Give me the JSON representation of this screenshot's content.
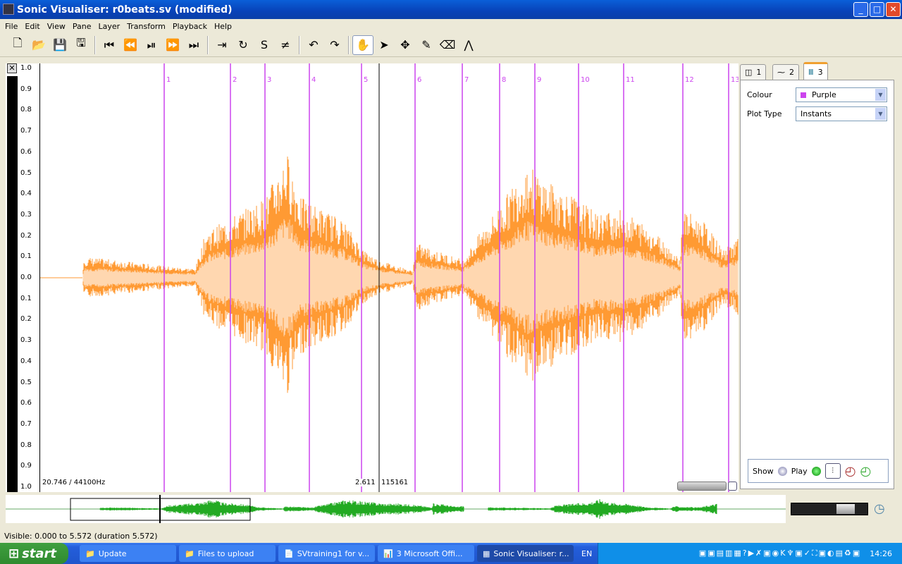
{
  "window": {
    "title": "Sonic Visualiser: r0beats.sv (modified)",
    "minimize": "_",
    "maximize": "□",
    "close": "✕"
  },
  "menu": [
    "File",
    "Edit",
    "View",
    "Pane",
    "Layer",
    "Transform",
    "Playback",
    "Help"
  ],
  "toolbar": [
    {
      "icon": "new-file-icon",
      "glyph": "🗋"
    },
    {
      "icon": "open-folder-icon",
      "glyph": "📂"
    },
    {
      "icon": "save-icon",
      "glyph": "💾"
    },
    {
      "icon": "save-as-icon",
      "glyph": "🖫"
    },
    {
      "sep": true
    },
    {
      "icon": "rewind-start-icon",
      "glyph": "⏮"
    },
    {
      "icon": "rewind-icon",
      "glyph": "⏪"
    },
    {
      "icon": "play-pause-icon",
      "glyph": "⏯"
    },
    {
      "icon": "fast-forward-icon",
      "glyph": "⏩"
    },
    {
      "icon": "fast-forward-end-icon",
      "glyph": "⏭"
    },
    {
      "sep": true
    },
    {
      "icon": "play-selection-icon",
      "glyph": "⇥"
    },
    {
      "icon": "loop-icon",
      "glyph": "↻"
    },
    {
      "icon": "solo-icon",
      "glyph": "S"
    },
    {
      "icon": "speed-icon",
      "glyph": "≠"
    },
    {
      "sep": true
    },
    {
      "icon": "undo-icon",
      "glyph": "↶"
    },
    {
      "icon": "redo-icon",
      "glyph": "↷"
    },
    {
      "sep": true
    },
    {
      "icon": "navigate-hand-icon",
      "glyph": "✋"
    },
    {
      "icon": "select-arrow-icon",
      "glyph": "➤"
    },
    {
      "icon": "move-icon",
      "glyph": "✥"
    },
    {
      "icon": "draw-pencil-icon",
      "glyph": "✎"
    },
    {
      "icon": "erase-icon",
      "glyph": "⌫"
    },
    {
      "icon": "measure-icon",
      "glyph": "⋀"
    }
  ],
  "scale_ticks": [
    "1.0",
    "0.9",
    "0.8",
    "0.7",
    "0.6",
    "0.5",
    "0.4",
    "0.3",
    "0.2",
    "0.1",
    "0.0",
    "0.1",
    "0.2",
    "0.3",
    "0.4",
    "0.5",
    "0.6",
    "0.7",
    "0.8",
    "0.9",
    "1.0"
  ],
  "beats": [
    "1",
    "2",
    "3",
    "4",
    "5",
    "6",
    "7",
    "8",
    "9",
    "10",
    "11",
    "12",
    "13"
  ],
  "colors": {
    "waveform": "#ff9a33",
    "waveform_fill": "#ffd7b0",
    "beat": "#cc44ee",
    "overview": "#22aa22"
  },
  "pane": {
    "rate": "20.746 / 44100Hz",
    "cursor_time": "2.611",
    "cursor_frame": "115161"
  },
  "panel": {
    "tabs": [
      "1",
      "2",
      "3"
    ],
    "colour_label": "Colour",
    "colour_value": "Purple",
    "colour_swatch": "#cc44ee",
    "plot_type_label": "Plot Type",
    "plot_type_value": "Instants",
    "show_label": "Show",
    "play_label": "Play"
  },
  "status": "Visible: 0.000 to 5.572 (duration 5.572)",
  "taskbar": {
    "start": "start",
    "tasks": [
      "Update",
      "Files to upload",
      "SVtraining1 for v...",
      "3 Microsoft Offi...",
      "Sonic Visualiser: r..."
    ],
    "lang": "EN",
    "clock": "14:26"
  }
}
